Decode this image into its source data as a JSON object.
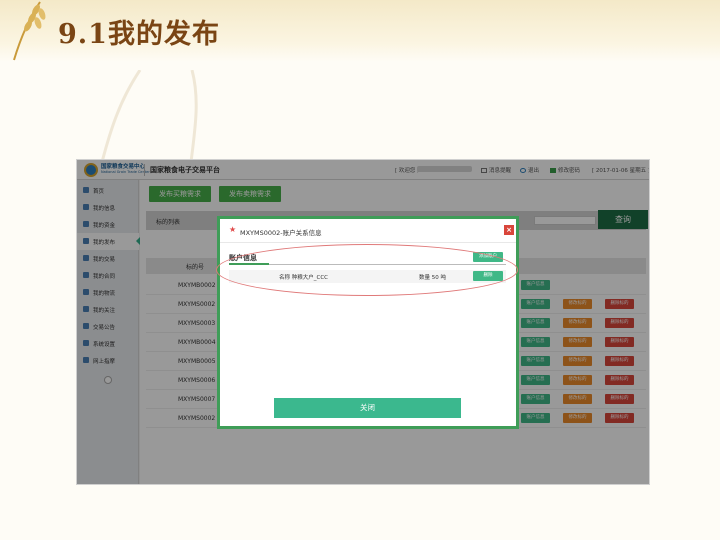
{
  "slide": {
    "title": "9.1我的发布"
  },
  "header": {
    "logo_cn": "国家粮食交易中心",
    "logo_en": "National Grain Trade Center",
    "platform_name": "国家粮食电子交易平台",
    "welcome": "[ 欢迎您 ,",
    "links": {
      "messages": "消息提醒",
      "logout": "退出",
      "change_password": "修改密码"
    },
    "date": "[ 2017-01-06 星期五 ]"
  },
  "sidebar": {
    "items": [
      {
        "label": "首页"
      },
      {
        "label": "我的信息"
      },
      {
        "label": "我的资金"
      },
      {
        "label": "我的发布"
      },
      {
        "label": "我的交易"
      },
      {
        "label": "我的合同"
      },
      {
        "label": "我的物流"
      },
      {
        "label": "我的关注"
      },
      {
        "label": "交易公告"
      },
      {
        "label": "系统设置"
      },
      {
        "label": "网上指摩"
      }
    ],
    "active_index": 3
  },
  "toolbar": {
    "publish_buy": "发布买粮需求",
    "publish_sell": "发布卖粮需求"
  },
  "filter": {
    "label": "标的列表"
  },
  "query_button": "查询",
  "table": {
    "header_id": "标的号",
    "rows": [
      {
        "id": "MXYMB0002"
      },
      {
        "id": "MXYMS0002"
      },
      {
        "id": "MXYMS0003"
      },
      {
        "id": "MXYMB0004"
      },
      {
        "id": "MXYMB0005"
      },
      {
        "id": "MXYMS0006"
      },
      {
        "id": "MXYMS0007"
      },
      {
        "id": "MXYMS0002"
      }
    ],
    "btn_info": "账户信息",
    "btn_edit": "修改标的",
    "btn_delete": "删除标的"
  },
  "modal": {
    "title": "MXYMS0002-账户关系信息",
    "section_title": "账户信息",
    "add_button": "添加账户",
    "account_name": "名称 种粮大户_CCC",
    "account_qty": "数量 50 吨",
    "delete_button": "删除",
    "close_button": "关闭",
    "close_icon": "×"
  },
  "colors": {
    "accent_green": "#46b04a",
    "info_green": "#40b887",
    "edit_orange": "#ec8a2a",
    "delete_red": "#d9463b",
    "annotation_ellipse": "#e07a7a"
  }
}
